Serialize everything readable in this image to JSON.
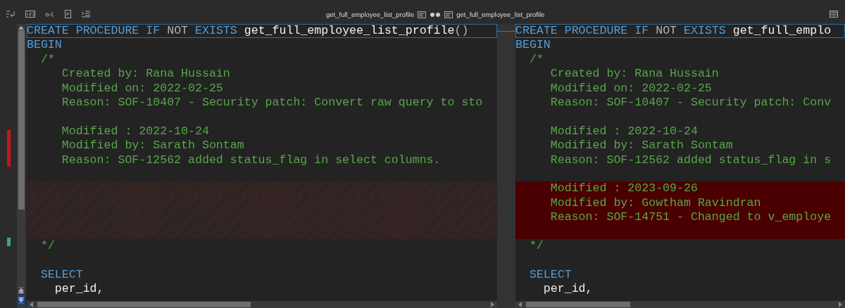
{
  "toolbar": {
    "left_title": "get_full_employee_list_profile",
    "right_title": "get_full_employee_list_profile"
  },
  "panes": [
    {
      "lines": [
        {
          "kind": "normal",
          "current": true,
          "tokens": [
            {
              "kind": "keyword",
              "text": "CREATE PROCEDURE IF "
            },
            {
              "kind": "plain",
              "text": "NOT "
            },
            {
              "kind": "keyword",
              "text": "EXISTS "
            },
            {
              "kind": "ident",
              "text": "get_full_employee_list_profile"
            },
            {
              "kind": "plain",
              "text": "()"
            }
          ]
        },
        {
          "kind": "normal",
          "current": false,
          "tokens": [
            {
              "kind": "keyword",
              "text": "BEGIN"
            }
          ]
        },
        {
          "kind": "normal",
          "current": false,
          "tokens": [
            {
              "kind": "comment",
              "text": "  /*"
            }
          ]
        },
        {
          "kind": "normal",
          "current": false,
          "tokens": [
            {
              "kind": "comment",
              "text": "     Created by: Rana Hussain"
            }
          ]
        },
        {
          "kind": "normal",
          "current": false,
          "tokens": [
            {
              "kind": "comment",
              "text": "     Modified on: 2022-02-25"
            }
          ]
        },
        {
          "kind": "normal",
          "current": false,
          "tokens": [
            {
              "kind": "comment",
              "text": "     Reason: SOF-10407 - Security patch: Convert raw query to sto"
            }
          ]
        },
        {
          "kind": "blank"
        },
        {
          "kind": "normal",
          "current": false,
          "tokens": [
            {
              "kind": "comment",
              "text": "     Modified : 2022-10-24"
            }
          ]
        },
        {
          "kind": "normal",
          "current": false,
          "tokens": [
            {
              "kind": "comment",
              "text": "     Modified by: Sarath Sontam"
            }
          ]
        },
        {
          "kind": "normal",
          "current": false,
          "tokens": [
            {
              "kind": "comment",
              "text": "     Reason: SOF-12562 added status_flag in select columns."
            }
          ]
        },
        {
          "kind": "blank"
        },
        {
          "kind": "placeholder",
          "current": false
        },
        {
          "kind": "placeholder",
          "current": false
        },
        {
          "kind": "placeholder",
          "current": false
        },
        {
          "kind": "placeholder",
          "current": false
        },
        {
          "kind": "normal",
          "current": false,
          "tokens": [
            {
              "kind": "comment",
              "text": "  */"
            }
          ]
        },
        {
          "kind": "blank"
        },
        {
          "kind": "normal",
          "current": false,
          "tokens": [
            {
              "kind": "keyword",
              "text": "  SELECT"
            }
          ]
        },
        {
          "kind": "normal",
          "current": false,
          "tokens": [
            {
              "kind": "ident",
              "text": "    per_id,"
            }
          ]
        }
      ]
    },
    {
      "lines": [
        {
          "kind": "normal",
          "current": true,
          "tokens": [
            {
              "kind": "keyword",
              "text": "CREATE PROCEDURE IF "
            },
            {
              "kind": "plain",
              "text": "NOT "
            },
            {
              "kind": "keyword",
              "text": "EXISTS "
            },
            {
              "kind": "ident",
              "text": "get_full_emplo"
            }
          ]
        },
        {
          "kind": "normal",
          "current": false,
          "tokens": [
            {
              "kind": "keyword",
              "text": "BEGIN"
            }
          ]
        },
        {
          "kind": "normal",
          "current": false,
          "tokens": [
            {
              "kind": "comment",
              "text": "  /*"
            }
          ]
        },
        {
          "kind": "normal",
          "current": false,
          "tokens": [
            {
              "kind": "comment",
              "text": "     Created by: Rana Hussain"
            }
          ]
        },
        {
          "kind": "normal",
          "current": false,
          "tokens": [
            {
              "kind": "comment",
              "text": "     Modified on: 2022-02-25"
            }
          ]
        },
        {
          "kind": "normal",
          "current": false,
          "tokens": [
            {
              "kind": "comment",
              "text": "     Reason: SOF-10407 - Security patch: Conv"
            }
          ]
        },
        {
          "kind": "blank"
        },
        {
          "kind": "normal",
          "current": false,
          "tokens": [
            {
              "kind": "comment",
              "text": "     Modified : 2022-10-24"
            }
          ]
        },
        {
          "kind": "normal",
          "current": false,
          "tokens": [
            {
              "kind": "comment",
              "text": "     Modified by: Sarath Sontam"
            }
          ]
        },
        {
          "kind": "normal",
          "current": false,
          "tokens": [
            {
              "kind": "comment",
              "text": "     Reason: SOF-12562 added status_flag in s"
            }
          ]
        },
        {
          "kind": "blank"
        },
        {
          "kind": "added",
          "current": false,
          "tokens": [
            {
              "kind": "comment",
              "text": "     Modified : 2023-09-26"
            }
          ]
        },
        {
          "kind": "added",
          "current": false,
          "tokens": [
            {
              "kind": "comment",
              "text": "     Modified by: Gowtham Ravindran"
            }
          ]
        },
        {
          "kind": "added",
          "current": false,
          "tokens": [
            {
              "kind": "comment",
              "text": "     Reason: SOF-14751 - Changed to v_employe"
            }
          ]
        },
        {
          "kind": "added",
          "current": false
        },
        {
          "kind": "normal",
          "current": false,
          "tokens": [
            {
              "kind": "comment",
              "text": "  */"
            }
          ]
        },
        {
          "kind": "blank"
        },
        {
          "kind": "normal",
          "current": false,
          "tokens": [
            {
              "kind": "keyword",
              "text": "  SELECT"
            }
          ]
        },
        {
          "kind": "normal",
          "current": false,
          "tokens": [
            {
              "kind": "ident",
              "text": "    per_id,"
            }
          ]
        }
      ]
    }
  ]
}
